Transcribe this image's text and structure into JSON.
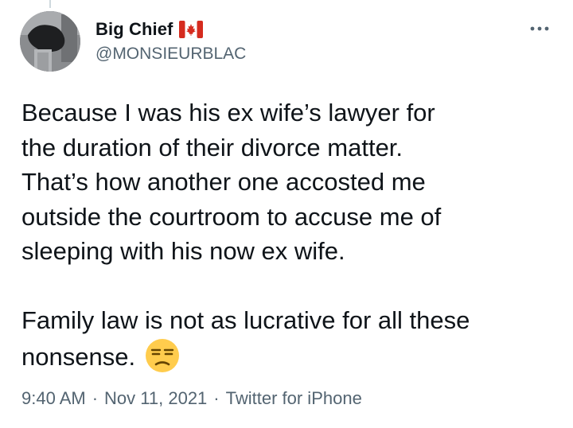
{
  "user": {
    "display_name": "Big Chief",
    "handle": "@MONSIEURBLAC",
    "badge_icon": "canada-flag-icon"
  },
  "tweet": {
    "paragraph1": "Because I was his ex wife’s lawyer for\nthe duration of their divorce matter.\nThat’s how another one accosted me\noutside the courtroom to accuse me of\nsleeping with his now ex wife.",
    "paragraph2": "Family law is not as lucrative for all these\nnonsense.",
    "emoji_icon": "unamused-face-icon"
  },
  "meta": {
    "time": "9:40 AM",
    "separator": "·",
    "date": "Nov 11, 2021",
    "source": "Twitter for iPhone"
  },
  "colors": {
    "text": "#0f1419",
    "secondary": "#536471",
    "flag_red": "#d52b1e"
  }
}
